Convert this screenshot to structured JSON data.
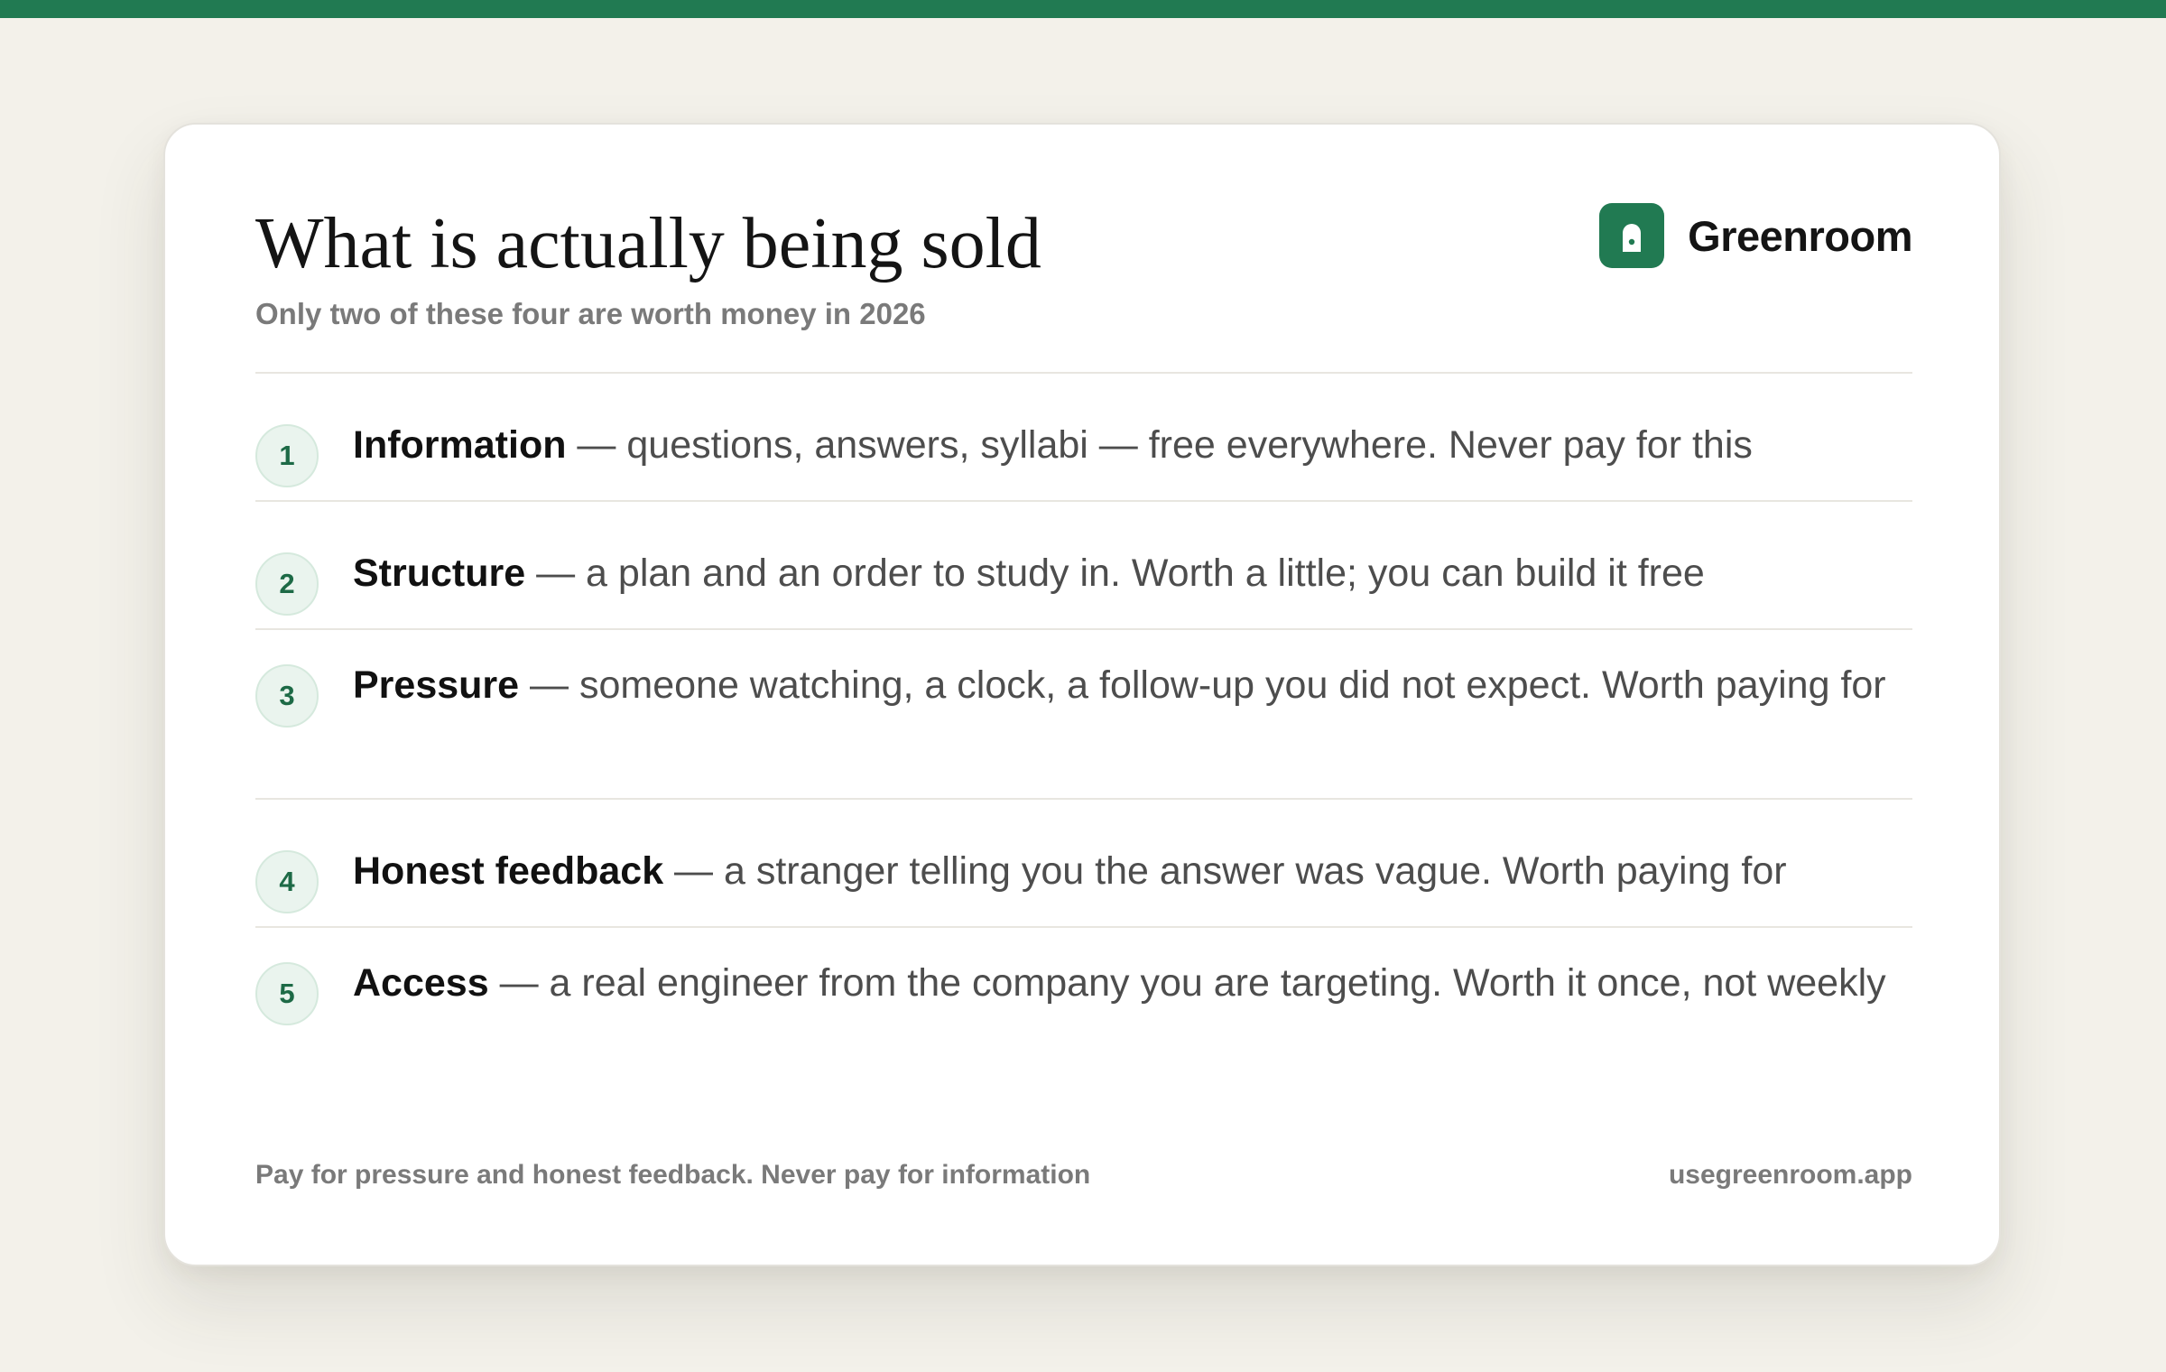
{
  "header": {
    "title": "What is actually being sold",
    "subtitle": "Only two of these four are worth money in 2026"
  },
  "brand": {
    "name": "Greenroom",
    "icon": "lock-icon",
    "color": "#217a52"
  },
  "items": [
    {
      "number": "1",
      "term": "Information",
      "description": " — questions, answers, syllabi — free everywhere. Never pay for this"
    },
    {
      "number": "2",
      "term": "Structure",
      "description": " — a plan and an order to study in. Worth a little; you can build it free"
    },
    {
      "number": "3",
      "term": "Pressure",
      "description": " — someone watching, a clock, a follow-up you did not expect. Worth paying for"
    },
    {
      "number": "4",
      "term": "Honest feedback",
      "description": " — a stranger telling you the answer was vague. Worth paying for"
    },
    {
      "number": "5",
      "term": "Access",
      "description": " — a real engineer from the company you are targeting. Worth it once, not weekly"
    }
  ],
  "footer": {
    "tagline": "Pay for pressure and honest feedback. Never pay for information",
    "url": "usegreenroom.app"
  },
  "colors": {
    "accent": "#217a52",
    "background": "#f3f1ea"
  }
}
